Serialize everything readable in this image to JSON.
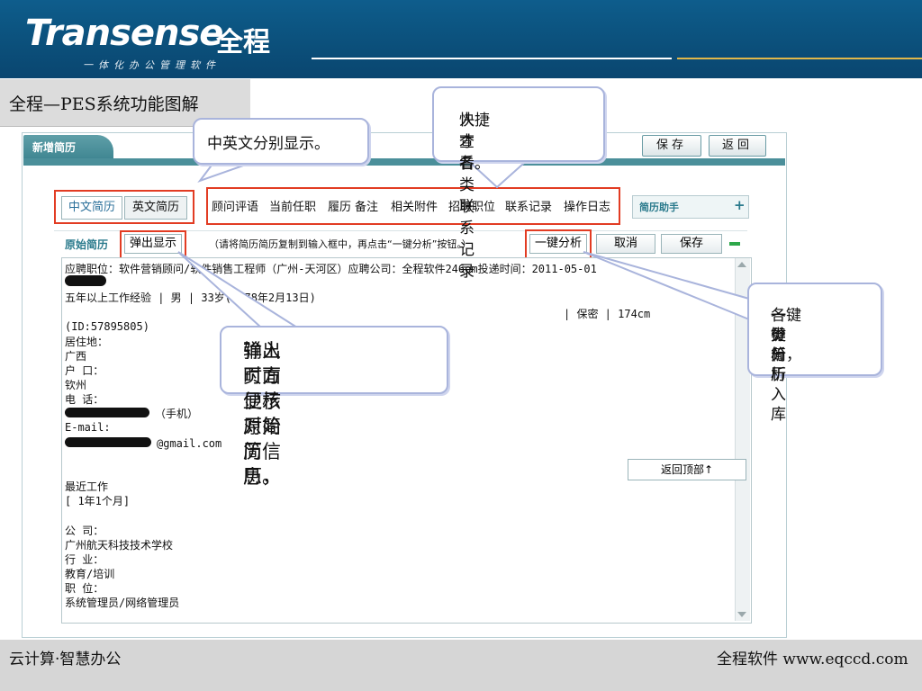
{
  "colors": {
    "header_bg": "#0b4f7a",
    "accent_teal": "#3e8591",
    "highlight_red": "#e23c23",
    "callout_border": "#a9b4dc",
    "footer_bg": "#d6d6d6",
    "gold_line": "#e1b84a"
  },
  "header": {
    "brand": "Transense",
    "brand_cn": "全程",
    "tagline": "一体化办公管理软件"
  },
  "slide_title": "全程—PES系统功能图解",
  "app": {
    "tab_new": "新增简历",
    "save_top": "保存",
    "back_top": "返回",
    "lang_tabs": [
      "中文简历",
      "英文简历"
    ],
    "nav_items": [
      "顾问评语",
      "当前任职",
      "履历",
      "备注",
      "相关附件",
      "招聘职位",
      "联系记录",
      "操作日志"
    ],
    "assistant": "简历助手",
    "orig_label": "原始简历",
    "popup_btn": "弹出显示",
    "hint": "（请将简历简历复制到输入框中，再点击“一键分析”按钮。）",
    "analyze_btn": "一键分析",
    "cancel_btn": "取消",
    "save_btn": "保存",
    "back_to_top": "返回顶部↑"
  },
  "resume": {
    "l1": "应聘职位：软件营销顾问/软件销售工程师（广州-天河区）应聘公司：全程软件246om投递时间：2011-05-01",
    "l3": "五年以上工作经验 | 男 | 33岁(1978年2月13日)",
    "l3b": "| 保密 | 174cm",
    "id": "(ID:57895805)",
    "addr_label": "居住地：",
    "addr": "广西",
    "hukou_label": "户  口：",
    "hukou": "钦州",
    "tel_label": "电  话：",
    "tel_suffix": "（手机）",
    "email_label": "E-mail:",
    "email_suffix": "@gmail.com",
    "recent": "最近工作",
    "duration": "[ 1年1个月]",
    "company_label": "公  司：",
    "company": "广州航天科技技术学校",
    "industry_label": "行  业：",
    "industry": "教育/培训",
    "position_label": "职  位：",
    "position": "系统管理员/网络管理员"
  },
  "callouts": {
    "c1": "中英文分别显示。",
    "c2_l1": "人才各类联系记录",
    "c2_l2": "快捷查看。",
    "c3_l1": "弹出页面显示原始简历，",
    "c3_l2": "输入时方便核对简历信息。",
    "c4_l1": "一键分析，",
    "c4_l2": "各类简历",
    "c4_l3": "一键分析入库"
  },
  "footer": {
    "left": "云计算·智慧办公",
    "right": "全程软件 www.eqccd.com"
  }
}
